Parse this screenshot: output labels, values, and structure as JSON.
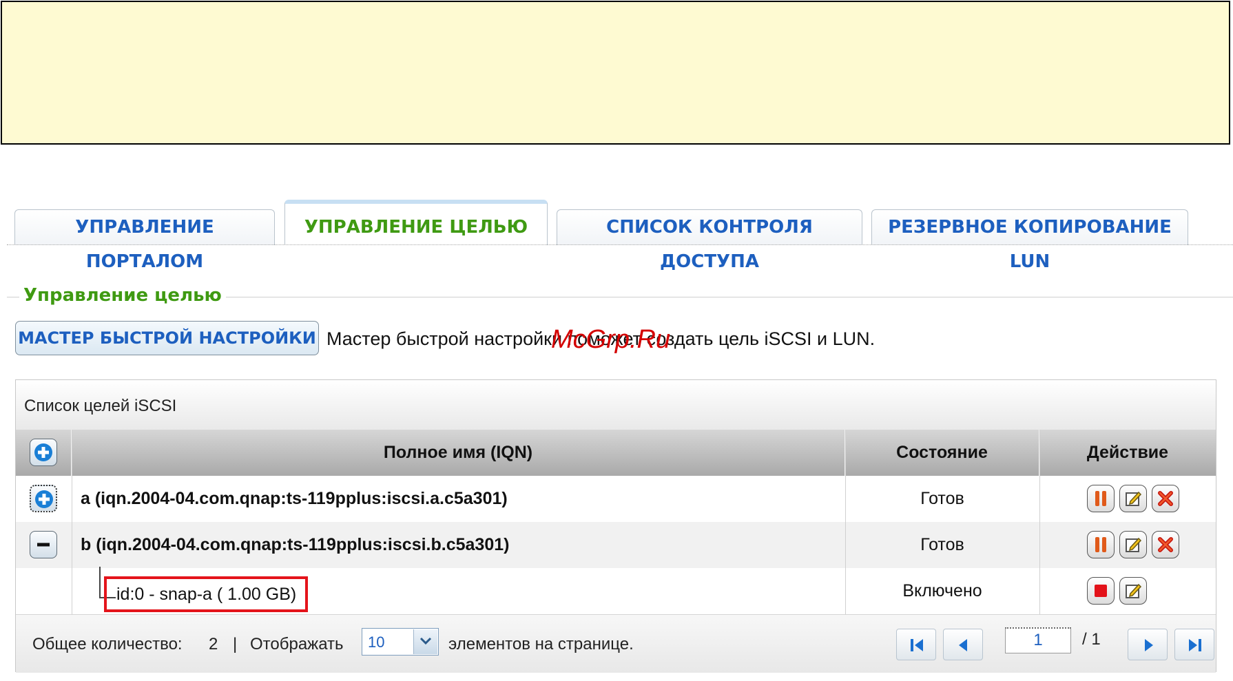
{
  "tabs": [
    {
      "label": "УПРАВЛЕНИЕ ПОРТАЛОМ",
      "active": false
    },
    {
      "label": "УПРАВЛЕНИЕ ЦЕЛЬЮ",
      "active": true
    },
    {
      "label": "СПИСОК КОНТРОЛЯ ДОСТУПА",
      "active": false
    },
    {
      "label": "РЕЗЕРВНОЕ КОПИРОВАНИЕ LUN",
      "active": false
    }
  ],
  "section": {
    "legend": "Управление целью",
    "wizard_button": "МАСТЕР БЫСТРОЙ НАСТРОЙКИ",
    "wizard_description": "Мастер быстрой настройки поможет создать цель iSCSI и LUN."
  },
  "watermark": "McGrp.Ru",
  "table": {
    "title": "Список целей iSCSI",
    "columns": {
      "name": "Полное имя (IQN)",
      "status": "Состояние",
      "action": "Действие"
    },
    "rows": [
      {
        "name": "a (iqn.2004-04.com.qnap:ts-119pplus:iscsi.a.c5a301)",
        "status": "Готов"
      },
      {
        "name": "b (iqn.2004-04.com.qnap:ts-119pplus:iscsi.b.c5a301)",
        "status": "Готов"
      }
    ],
    "lun": {
      "name": "id:0 - snap-a ( 1.00 GB)",
      "status": "Включено"
    }
  },
  "footer": {
    "total_label": "Общее количество:",
    "total_value": "2",
    "separator": "|",
    "show_label": "Отображать",
    "per_page": "10",
    "items_label": "элементов на странице.",
    "page": "1",
    "page_total": "/ 1"
  },
  "colors": {
    "tab_text": "#1d5fbf",
    "active_tab_text": "#3f9a12",
    "highlight_border": "#e4141b",
    "banner": "#fefad2"
  }
}
